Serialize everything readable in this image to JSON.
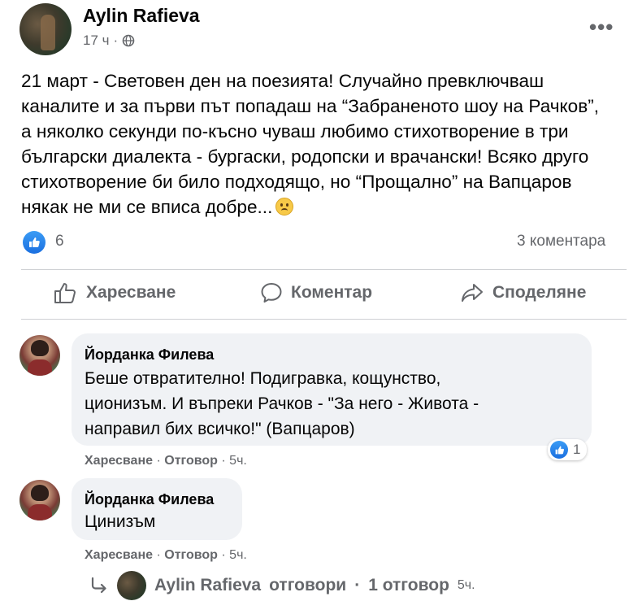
{
  "post": {
    "author": "Aylin Rafieva",
    "time": "17 ч",
    "separator": "·",
    "more_label": "•••",
    "text_lines": [
      "21 март - Световен ден на поезията! Случайно превключваш",
      "каналите и за първи път попадаш на “Забраненото шоу на Рачков”,",
      "а няколко секунди по-късно чуваш любимо стихотворение в три",
      "български диалекта - бургаски, родопски и врачански! Всяко друго",
      "стихотворение би било подходящо, но “Прощално” на Вапцаров",
      "някак не ми се вписа добре..."
    ],
    "reaction_count": "6",
    "comments_count": "3 коментара"
  },
  "actions": {
    "like": "Харесване",
    "comment": "Коментар",
    "share": "Споделяне"
  },
  "comments": [
    {
      "name": "Йорданка Филева",
      "text_lines": [
        "Беше отвратително! Подигравка, кощунство,",
        "ционизъм. И въпреки Рачков - \"За него - Живота -",
        "направил бих всичко!\" (Вапцаров)"
      ],
      "like": "Харесване",
      "reply": "Отговор",
      "time": "5ч.",
      "reactions": "1"
    },
    {
      "name": "Йорданка Филева",
      "text_lines": [
        "Цинизъм"
      ],
      "like": "Харесване",
      "reply": "Отговор",
      "time": "5ч."
    }
  ],
  "reply_summary": {
    "author": "Aylin Rafieva",
    "label": "отговори",
    "count": "1 отговор",
    "time": "5ч."
  },
  "colors": {
    "secondary_text": "#65676b",
    "bubble": "#f0f2f5",
    "like_blue": "#1877f2",
    "divider": "#ced0d4"
  }
}
